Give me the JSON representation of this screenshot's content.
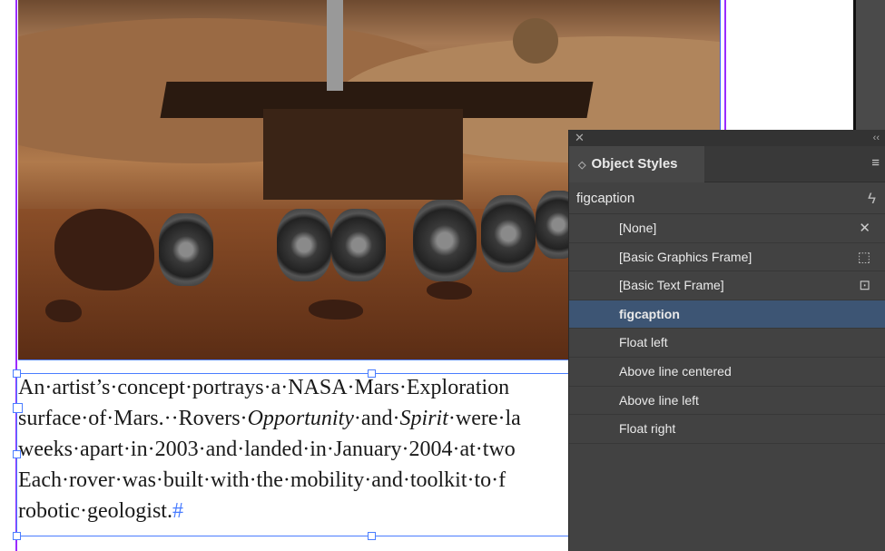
{
  "caption": {
    "lines": [
      "An·artist’s·concept·portrays·a·NASA·Mars·Exploration",
      "surface·of·Mars.··Rovers·",
      "weeks·apart·in·2003·and·landed·in·January·2004·at·two",
      "Each·rover·was·built·with·the·mobility·and·toolkit·to·f",
      "robotic·geologist."
    ],
    "line2_italic1": "Opportunity",
    "line2_mid": "·and·",
    "line2_italic2": "Spirit",
    "line2_end": "·were·la",
    "end_mark": "#"
  },
  "panel": {
    "close_icon": "close-icon",
    "collapse_label": "‹‹",
    "title": "Object Styles",
    "current_style": "figcaption",
    "styles": [
      {
        "label": "[None]",
        "icon": "pen-cross-icon",
        "glyph": "✕"
      },
      {
        "label": "[Basic Graphics Frame]",
        "icon": "graphics-frame-icon",
        "glyph": "⬚"
      },
      {
        "label": "[Basic Text Frame]",
        "icon": "text-frame-icon",
        "glyph": "⊡"
      },
      {
        "label": "figcaption",
        "selected": true
      },
      {
        "label": "Float left"
      },
      {
        "label": "Above line centered"
      },
      {
        "label": "Above line left"
      },
      {
        "label": "Float right"
      }
    ],
    "selection_color": "#3d5574"
  }
}
